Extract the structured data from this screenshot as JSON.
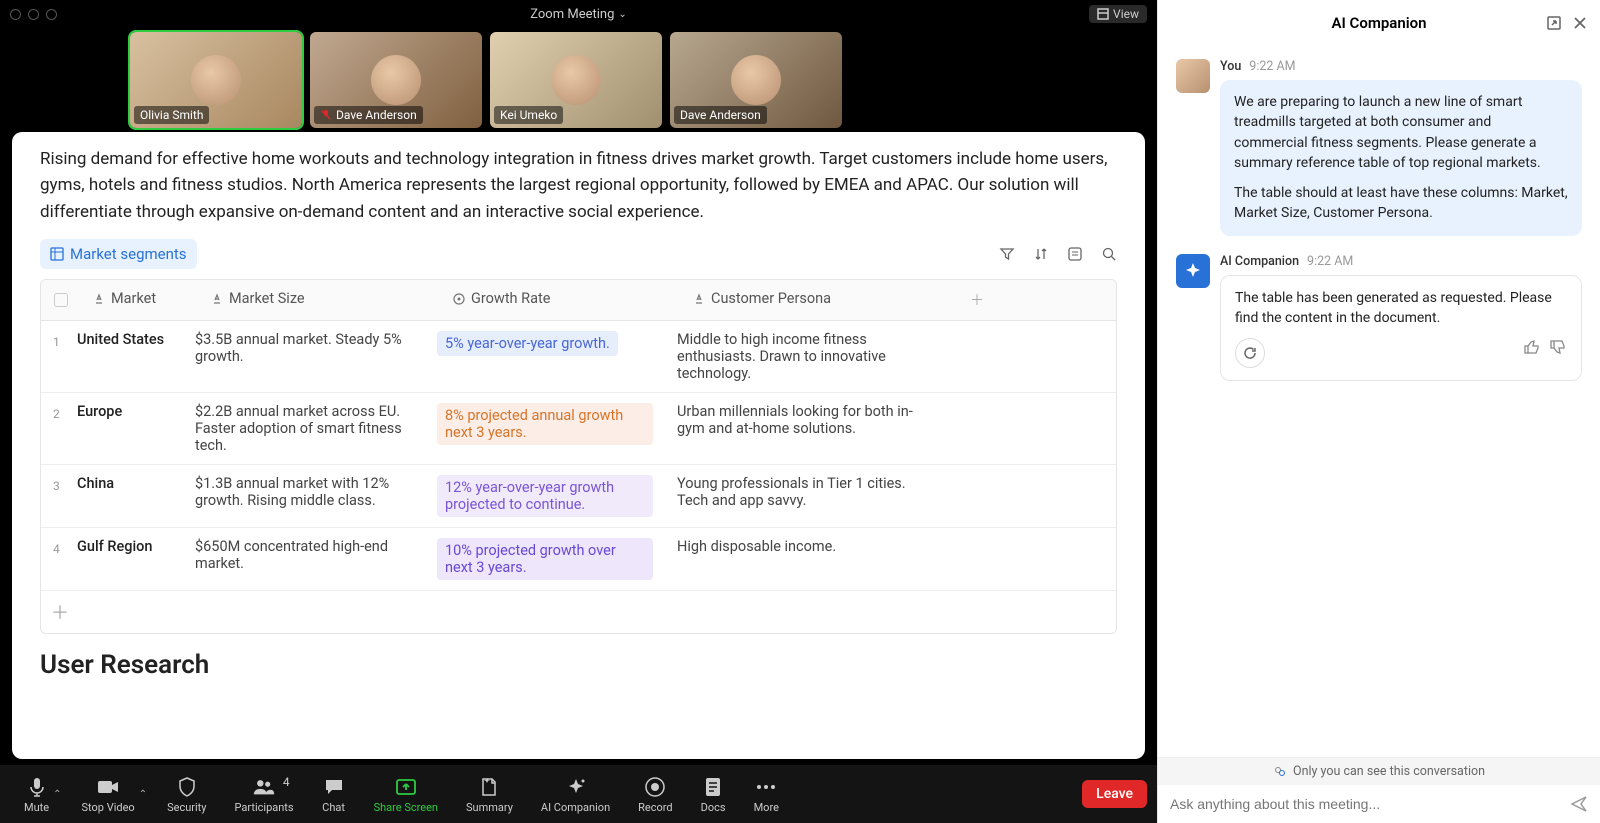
{
  "window": {
    "title": "Zoom Meeting",
    "view_button": "View"
  },
  "participants": [
    {
      "name": "Olivia Smith",
      "muted": false,
      "active": true
    },
    {
      "name": "Dave Anderson",
      "muted": true,
      "active": false
    },
    {
      "name": "Kei Umeko",
      "muted": false,
      "active": false
    },
    {
      "name": "Dave Anderson",
      "muted": false,
      "active": false
    }
  ],
  "document": {
    "intro": "Rising demand for effective home workouts and technology integration in fitness drives market growth. Target customers include home users, gyms, hotels and fitness studios. North America represents the largest regional opportunity, followed by EMEA and APAC. Our solution will differentiate through expansive on-demand content and an interactive social experience.",
    "chip_label": "Market segments",
    "columns": {
      "market": "Market",
      "market_size": "Market Size",
      "growth_rate": "Growth Rate",
      "customer_persona": "Customer Persona"
    },
    "rows": [
      {
        "idx": "1",
        "market": "United States",
        "size": "$3.5B annual market. Steady 5% growth.",
        "growth": "5% year-over-year growth.",
        "growth_style": "blue",
        "persona": "Middle to high income fitness enthusiasts. Drawn to innovative technology."
      },
      {
        "idx": "2",
        "market": "Europe",
        "size": "$2.2B annual market across EU. Faster adoption of smart fitness tech.",
        "growth": "8% projected annual growth next 3 years.",
        "growth_style": "orange",
        "persona": "Urban millennials looking for both in-gym and at-home solutions."
      },
      {
        "idx": "3",
        "market": "China",
        "size": "$1.3B annual market with 12% growth. Rising middle class.",
        "growth": "12% year-over-year growth projected to continue.",
        "growth_style": "purple",
        "persona": "Young professionals in Tier 1 cities. Tech and app savvy."
      },
      {
        "idx": "4",
        "market": "Gulf Region",
        "size": "$650M concentrated high-end market.",
        "growth": "10% projected growth over next 3 years.",
        "growth_style": "purple2",
        "persona": "High disposable income."
      }
    ],
    "next_heading": "User Research"
  },
  "toolbar": {
    "mute": "Mute",
    "stop_video": "Stop Video",
    "security": "Security",
    "participants": "Participants",
    "participants_count": "4",
    "chat": "Chat",
    "share_screen": "Share Screen",
    "summary": "Summary",
    "ai_companion": "AI Companion",
    "record": "Record",
    "docs": "Docs",
    "more": "More",
    "leave": "Leave"
  },
  "ai_panel": {
    "title": "AI Companion",
    "messages": [
      {
        "sender": "You",
        "time": "9:22 AM",
        "paragraphs": [
          "We are preparing to launch a new line of smart treadmills targeted at both consumer and commercial fitness segments. Please generate a summary reference table of top regional markets.",
          "The table should at least have these columns: Market, Market Size, Customer Persona."
        ]
      },
      {
        "sender": "AI Companion",
        "time": "9:22 AM",
        "paragraphs": [
          "The table has been generated as requested. Please find the content in the document."
        ]
      }
    ],
    "privacy_note": "Only you can see this conversation",
    "input_placeholder": "Ask anything about this meeting..."
  }
}
